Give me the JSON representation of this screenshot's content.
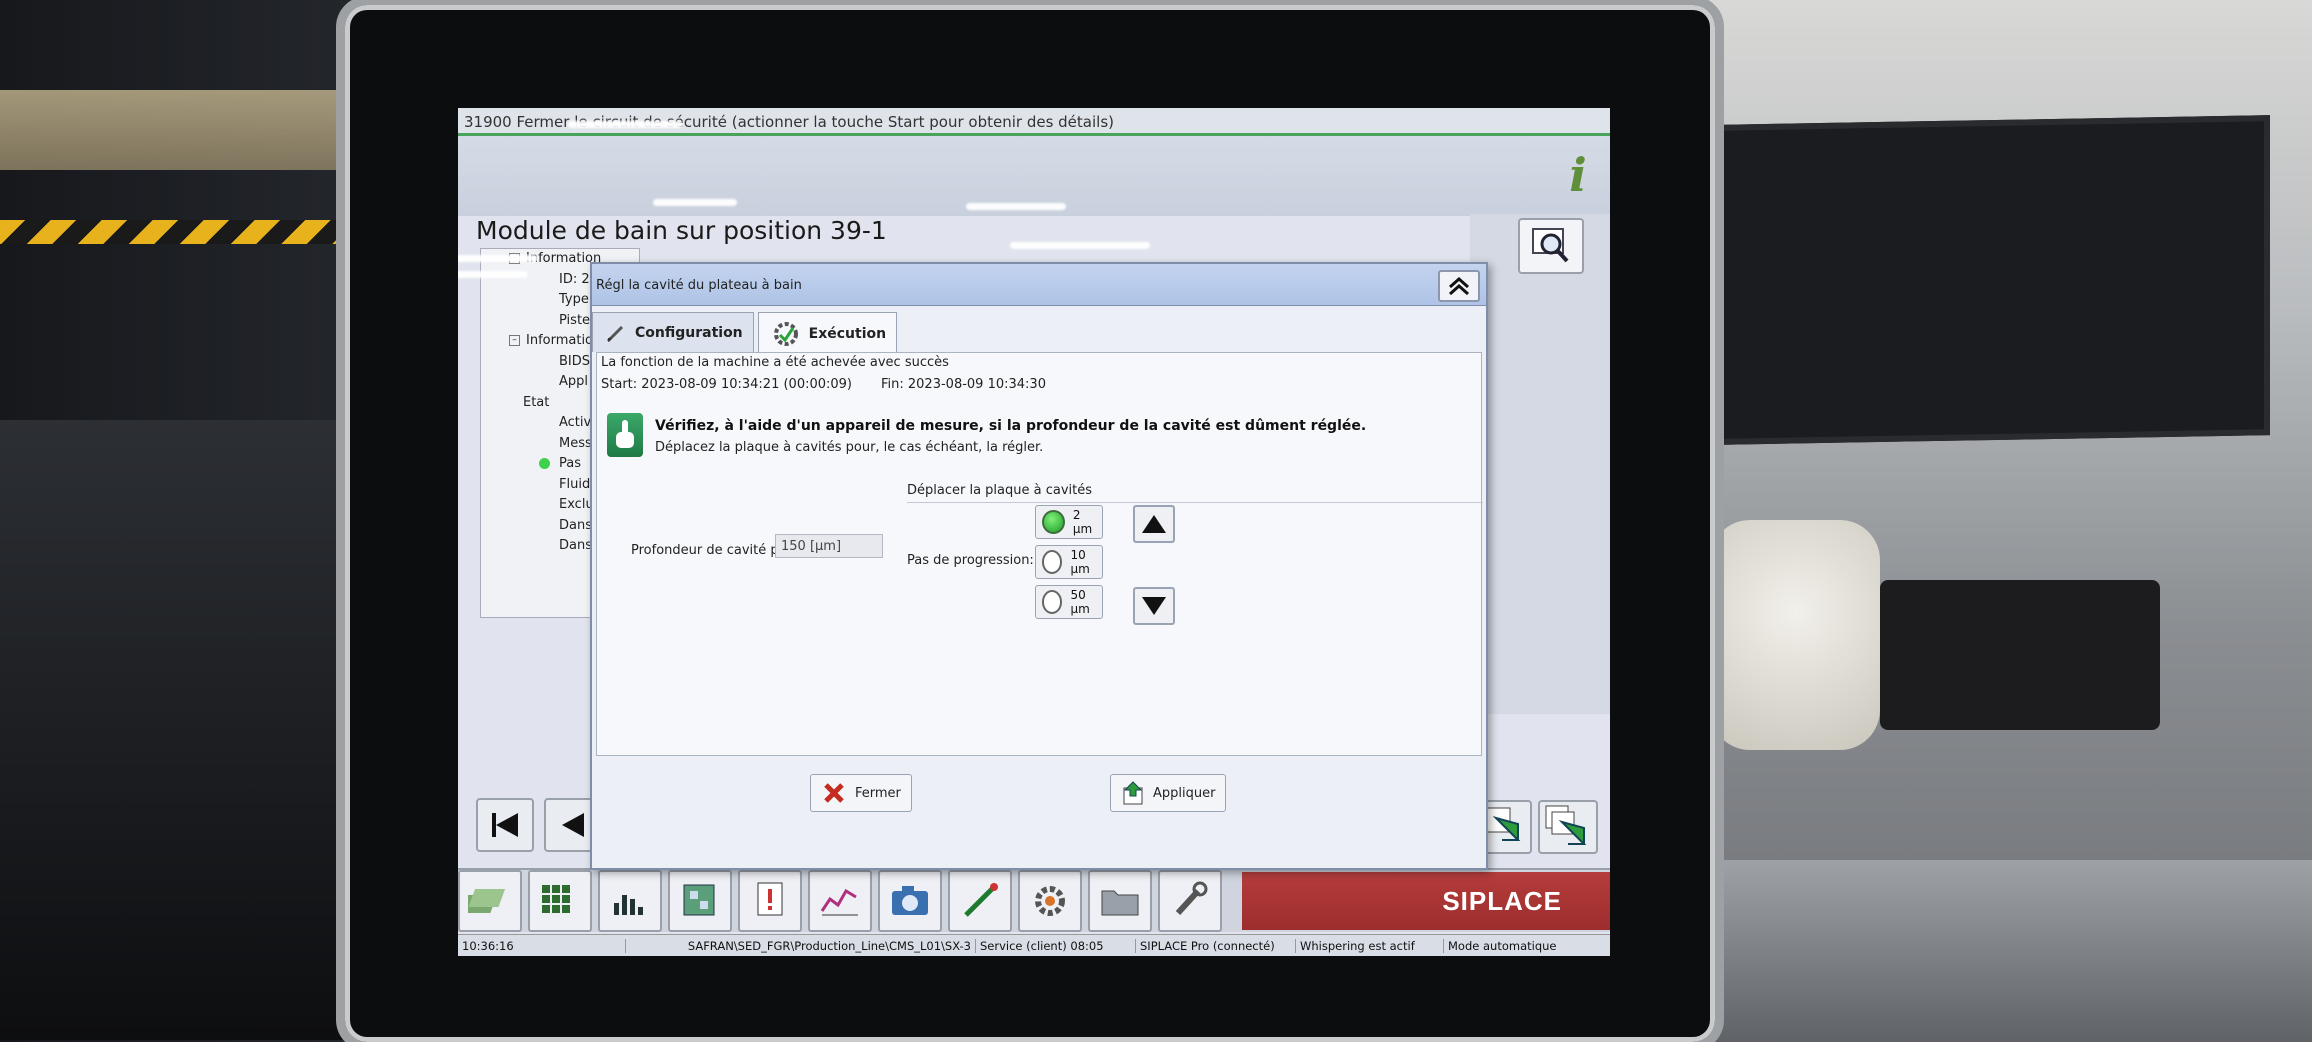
{
  "status_bar": {
    "message": "31900 Fermer le circuit de sécurité (actionner la touche Start pour obtenir des détails)"
  },
  "header": {
    "info_icon": "i",
    "page_title": "Module de bain sur position 39-1"
  },
  "tree": {
    "items": [
      {
        "text": "Information",
        "level": 0
      },
      {
        "text": "ID: 2",
        "level": 1
      },
      {
        "text": "Type",
        "level": 1
      },
      {
        "text": "Piste",
        "level": 1
      },
      {
        "text": "Information",
        "level": 0
      },
      {
        "text": "BIDS",
        "level": 1
      },
      {
        "text": "Appl",
        "level": 1
      },
      {
        "text": "Etat",
        "level": 0
      },
      {
        "text": "Activ",
        "level": 1
      },
      {
        "text": "Mess",
        "level": 1
      },
      {
        "text": "Pas",
        "level": 1
      },
      {
        "text": "Fluid",
        "level": 1
      },
      {
        "text": "Exclu",
        "level": 1
      },
      {
        "text": "Dans",
        "level": 1
      },
      {
        "text": "Dans",
        "level": 1
      }
    ]
  },
  "dialog": {
    "title": "Régl  la cavité du plateau à bain",
    "tabs": [
      {
        "label": "Configuration",
        "icon": "wrench-icon"
      },
      {
        "label": "Exécution",
        "icon": "gear-check-icon"
      }
    ],
    "active_tab": "Exécution",
    "result_message": "La fonction de la machine a été achevée avec succès",
    "start_text": "Start: 2023-08-09 10:34:21 (00:00:09)",
    "end_text": "Fin: 2023-08-09 10:34:30",
    "hint_bold": "Vérifiez, à l'aide d'un appareil de mesure, si la profondeur de la cavité est dûment réglée.",
    "hint_sub": "Déplacez la plaque à cavités pour, le cas échéant, la régler.",
    "move_section_title": "Déplacer la plaque à cavités",
    "depth_label": "Profondeur de cavité préréglée:",
    "depth_value": "150 [µm]",
    "step_label": "Pas de progression:",
    "step_options": [
      "2 µm",
      "10 µm",
      "50 µm"
    ],
    "selected_step": "2 µm",
    "close_button": "Fermer",
    "apply_button": "Appliquer"
  },
  "brand": "SIPLACE",
  "taskbar": {
    "time": "10:36:16",
    "path": "SAFRAN\\SED_FGR\\Production_Line\\CMS_L01\\SX-3",
    "service": "Service (client)",
    "service_time": "08:05",
    "pro": "SIPLACE Pro (connecté)",
    "whisper": "Whispering est actif",
    "mode": "Mode automatique"
  },
  "colors": {
    "status_green": "#4aa35a",
    "brand_red": "#a83333",
    "radio_selected": "#1d9b25",
    "dialog_title": "#aec3e6"
  }
}
